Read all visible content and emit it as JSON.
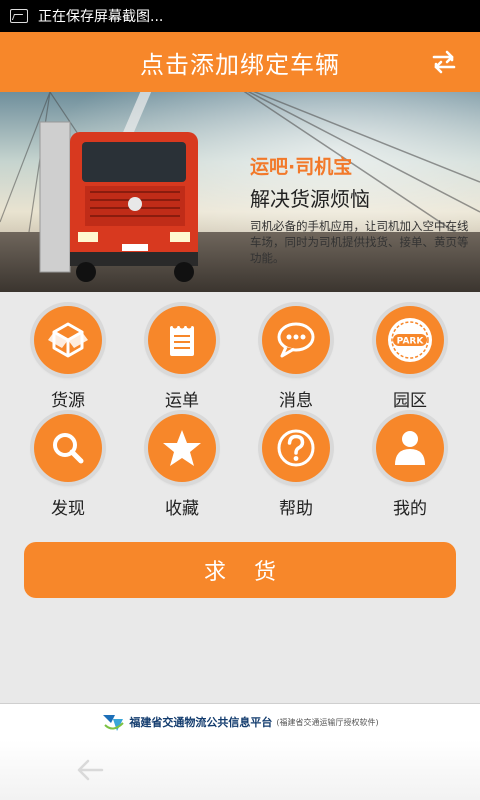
{
  "status_bar": {
    "text": "正在保存屏幕截图..."
  },
  "header": {
    "title": "点击添加绑定车辆",
    "switch_icon": "swap-icon"
  },
  "banner": {
    "brand": "运吧·司机宝",
    "slogan": "解决货源烦恼",
    "description": "司机必备的手机应用，让司机加入空中在线车场，同时为司机提供找货、接单、黄页等功能。"
  },
  "menu": [
    {
      "label": "货源",
      "icon": "box-icon"
    },
    {
      "label": "运单",
      "icon": "notepad-icon"
    },
    {
      "label": "消息",
      "icon": "chat-bubble-icon"
    },
    {
      "label": "园区",
      "icon": "park-badge-icon",
      "badge_text": "PARK"
    },
    {
      "label": "发现",
      "icon": "search-icon"
    },
    {
      "label": "收藏",
      "icon": "star-icon"
    },
    {
      "label": "帮助",
      "icon": "question-icon"
    },
    {
      "label": "我的",
      "icon": "user-icon"
    }
  ],
  "primary_button": {
    "label": "求货"
  },
  "footer": {
    "title": "福建省交通物流公共信息平台",
    "subtitle": "(福建省交通运输厅授权软件)"
  },
  "nav": {
    "back_icon": "back-arrow-icon"
  },
  "colors": {
    "accent": "#f7872a"
  }
}
